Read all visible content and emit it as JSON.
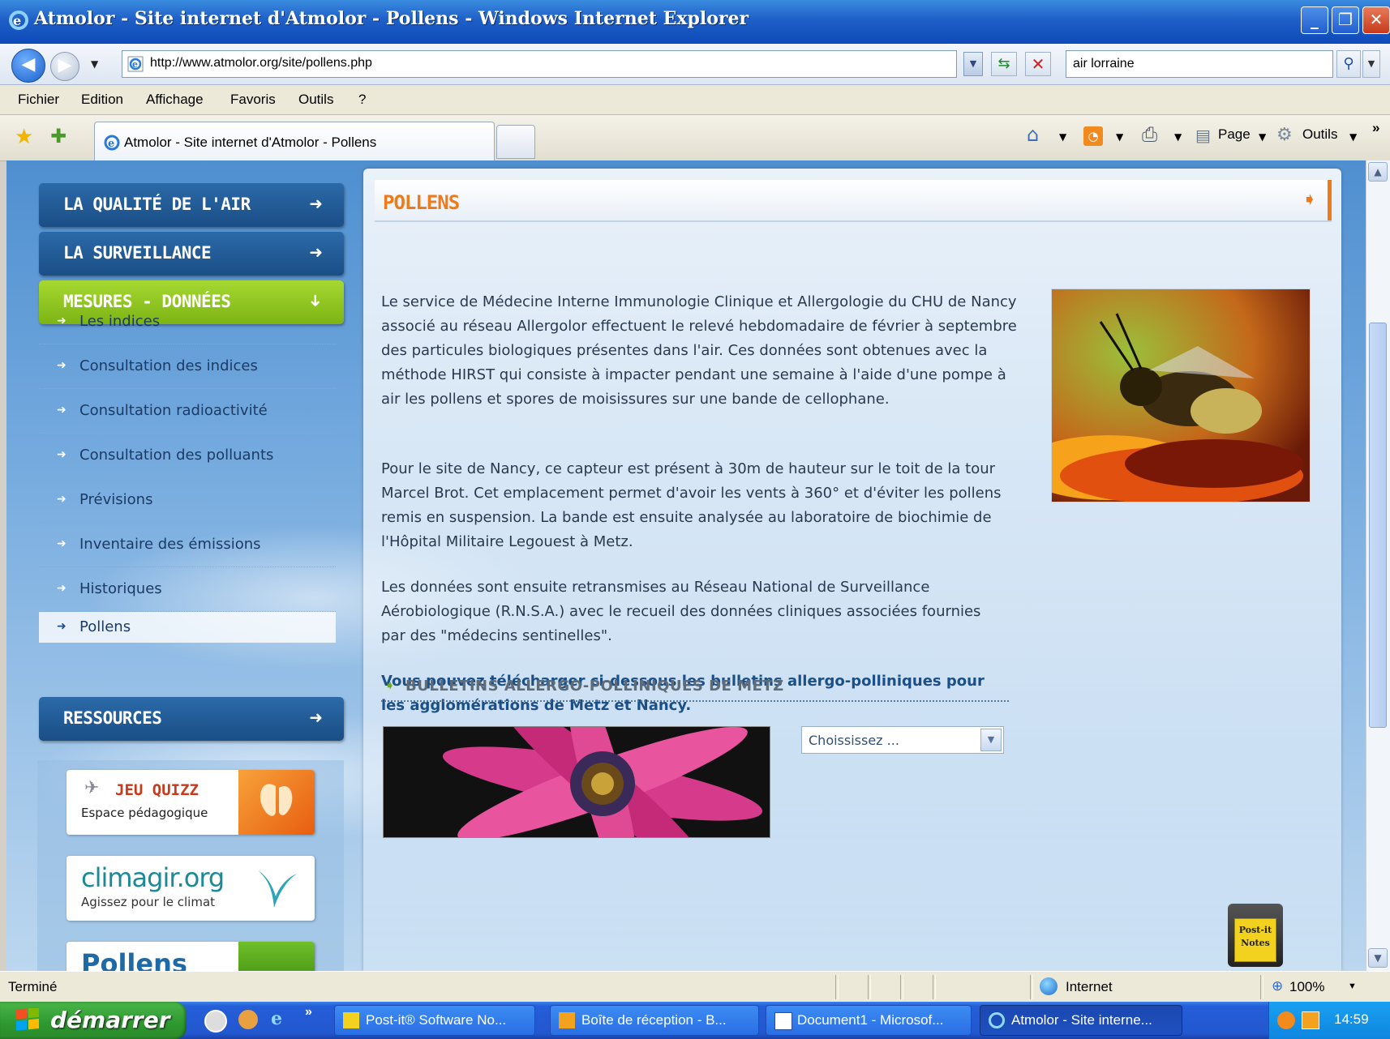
{
  "window": {
    "title": "Atmolor - Site internet d'Atmolor - Pollens - Windows Internet Explorer",
    "min": "_",
    "max": "❐",
    "close": "✕"
  },
  "address_bar": {
    "url": "http://www.atmolor.org/site/pollens.php",
    "search_value": "air lorraine"
  },
  "menu": [
    "Fichier",
    "Edition",
    "Affichage",
    "Favoris",
    "Outils",
    "?"
  ],
  "tab": {
    "title": "Atmolor - Site internet d'Atmolor - Pollens"
  },
  "commands": {
    "page": "Page",
    "tools": "Outils",
    "chevron": "»"
  },
  "nav": {
    "sections": [
      {
        "label": "LA QUALITÉ DE L'AIR",
        "arrow": "➜"
      },
      {
        "label": "LA SURVEILLANCE",
        "arrow": "➜"
      },
      {
        "label": "MESURES - DONNÉES",
        "arrow": "➜"
      }
    ],
    "items": [
      {
        "label": "Les indices"
      },
      {
        "label": "Consultation des indices"
      },
      {
        "label": "Consultation radioactivité"
      },
      {
        "label": "Consultation des polluants"
      },
      {
        "label": "Prévisions"
      },
      {
        "label": "Inventaire des émissions"
      },
      {
        "label": "Historiques"
      },
      {
        "label": "Pollens"
      }
    ],
    "resources": {
      "label": "RESSOURCES",
      "arrow": "➜"
    },
    "promos": {
      "quizz_title": "JEU QUIZZ",
      "quizz_sub": "Espace pédagogique",
      "climagir_title": "climagir.org",
      "climagir_sub": "Agissez pour le climat",
      "pollens_title": "Pollens"
    }
  },
  "content": {
    "title": "POLLENS",
    "paragraphs": [
      "Le service de Médecine Interne Immunologie Clinique et Allergologie du CHU de Nancy associé au réseau Allergolor effectuent le relevé hebdomadaire de février à septembre des particules biologiques présentes dans l'air. Ces données sont obtenues avec la méthode HIRST qui consiste à impacter pendant une semaine à l'aide d'une pompe à air les pollens et spores de moisissures sur une bande de cellophane.",
      "Pour le site de Nancy, ce capteur est présent à 30m de hauteur sur le toit de la tour Marcel Brot. Cet emplacement permet d'avoir les vents à 360° et d'éviter les pollens remis en suspension. La bande est ensuite analysée au laboratoire de biochimie de l'Hôpital Militaire Legouest à Metz.",
      "Les données sont ensuite retransmises au Réseau National de Surveillance Aérobiologique (R.N.S.A.) avec le recueil des données cliniques associées fournies par des \"médecins sentinelles\"."
    ],
    "download_note": "Vous pouvez télécharger ci-dessous les bulletins allergo-polliniques pour les agglomérations de Metz et Nancy.",
    "bulletins_title": "BULLETINS ALLERGO-POLLINIQUES DE METZ",
    "select_value": "Choississez ..."
  },
  "postit": {
    "line1": "Post-it",
    "line2": "Notes"
  },
  "status": {
    "text": "Terminé",
    "zone": "Internet",
    "zoom": "100%"
  },
  "taskbar": {
    "start": "démarrer",
    "quicklaunch_more": "»",
    "buttons": [
      {
        "label": "Post-it® Software No..."
      },
      {
        "label": "Boîte de réception - B..."
      },
      {
        "label": "Document1 - Microsof..."
      },
      {
        "label": "Atmolor - Site interne..."
      }
    ],
    "time": "14:59"
  },
  "colors": {
    "accent_orange": "#ee7a18",
    "nav_blue": "#1a4e86",
    "nav_green": "#8cc21f",
    "link_blue": "#1b4f86"
  }
}
